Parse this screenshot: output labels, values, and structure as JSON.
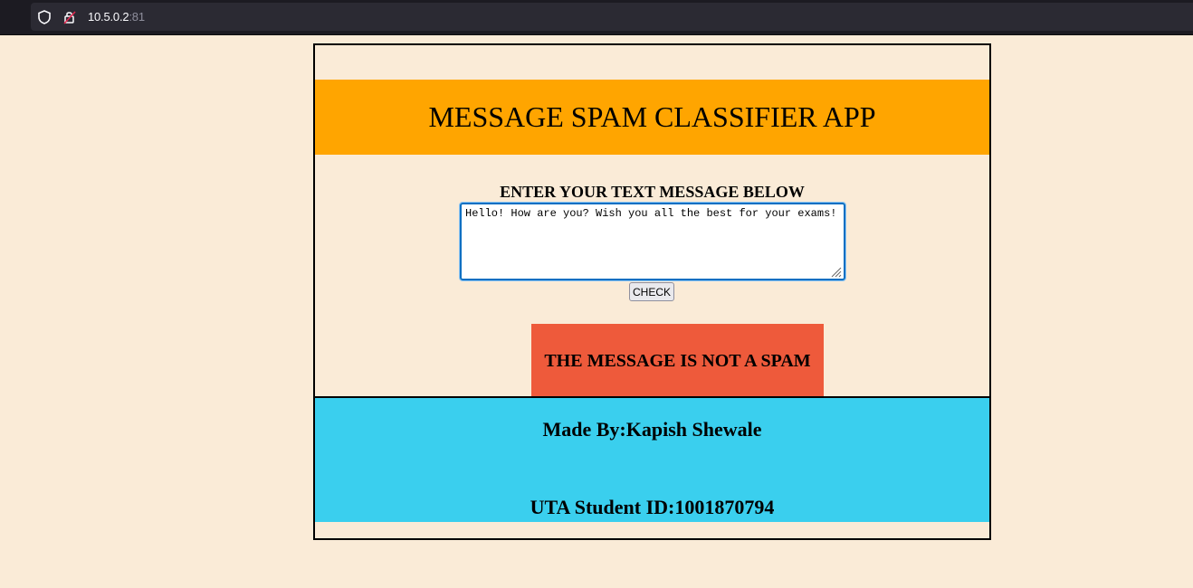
{
  "browser": {
    "url_host": "10.5.0.2",
    "url_port": ":81"
  },
  "app": {
    "title": "MESSAGE SPAM CLASSIFIER APP",
    "prompt_label": "ENTER YOUR TEXT MESSAGE BELOW",
    "message_value": "Hello! How are you? Wish you all the best for your exams!",
    "check_label": "CHECK",
    "result_text": "THE MESSAGE IS NOT A SPAM"
  },
  "footer": {
    "author": "Made By:Kapish Shewale",
    "student_id": "UTA Student ID:1001870794"
  },
  "colors": {
    "page_bg": "#faebd7",
    "header_bg": "#ffa500",
    "result_bg": "#ee5a3b",
    "footer_bg": "#3acfee"
  },
  "icons": [
    "shield-icon",
    "lock-icon",
    "resize-grip-icon"
  ]
}
